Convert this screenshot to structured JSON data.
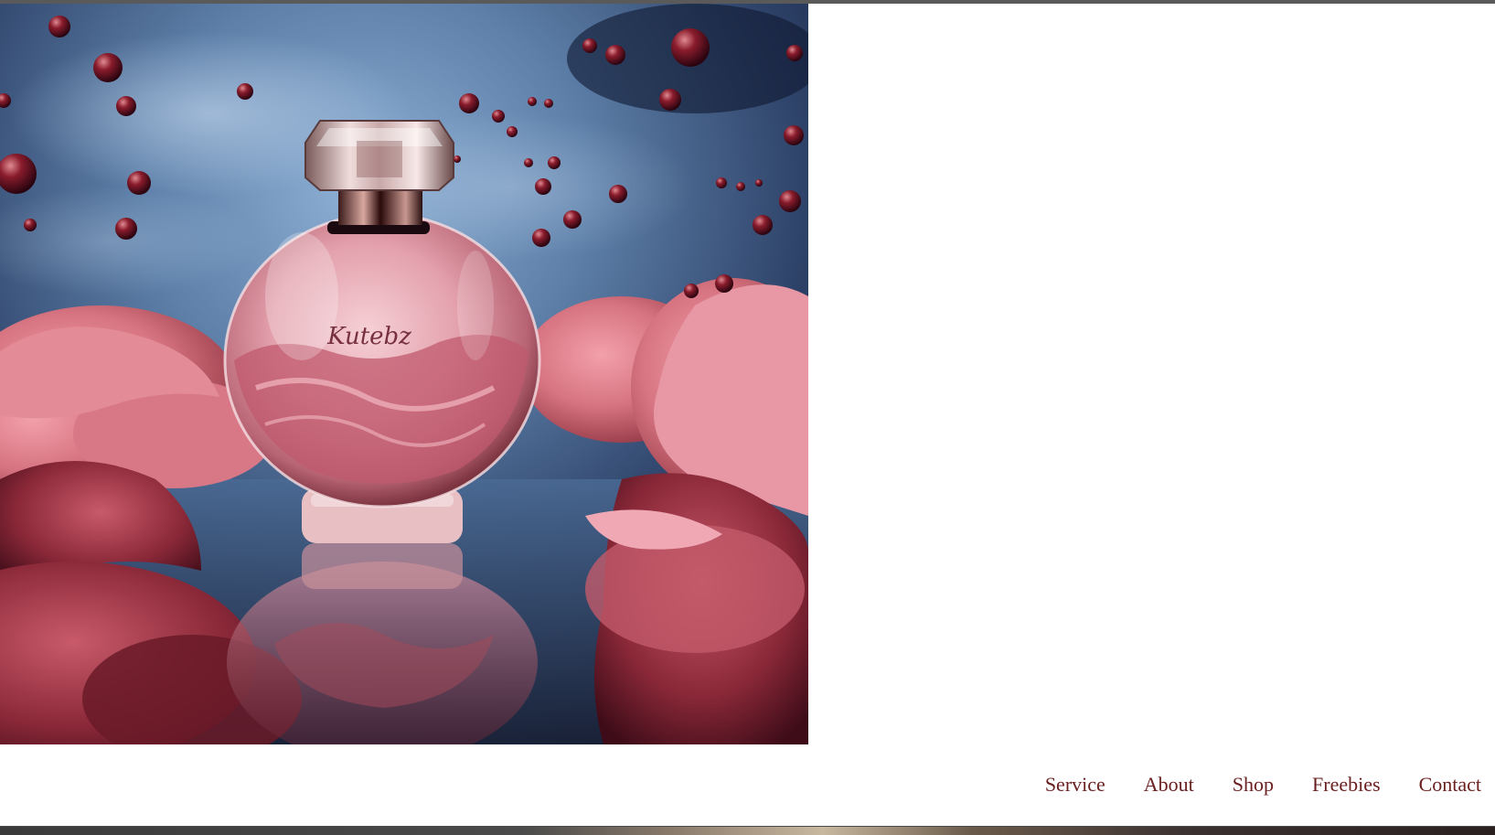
{
  "hero": {
    "image_alt": "Pink perfume bottle surrounded by pink roses and floating red droplets on a blue misty background",
    "bottle_engraving": "Kutebz"
  },
  "nav": {
    "items": [
      {
        "label": "Service"
      },
      {
        "label": "About"
      },
      {
        "label": "Shop"
      },
      {
        "label": "Freebies"
      },
      {
        "label": "Contact"
      }
    ]
  },
  "colors": {
    "nav_text": "#6b2020",
    "background": "#ffffff"
  }
}
